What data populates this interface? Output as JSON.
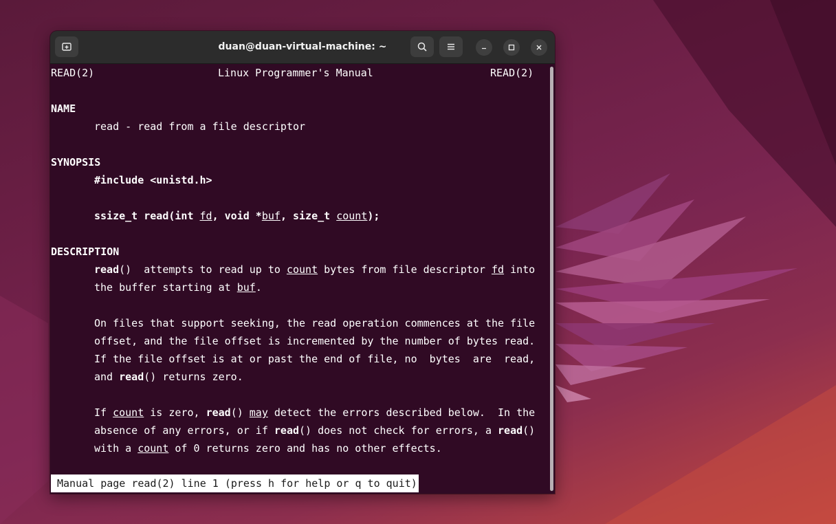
{
  "window": {
    "title": "duan@duan-virtual-machine: ~"
  },
  "icons": {
    "new_tab": "new-tab-icon",
    "search": "search-icon",
    "menu": "hamburger-menu-icon",
    "minimize": "minimize-icon",
    "maximize": "maximize-icon",
    "close": "close-icon"
  },
  "colors": {
    "terminal_bg": "#300a24",
    "terminal_fg": "#ffffff",
    "titlebar_bg": "#2c2c2c"
  },
  "man": {
    "header_left": "READ(2)",
    "header_center": "Linux Programmer's Manual",
    "header_right": "READ(2)",
    "name_heading": "NAME",
    "name_text": "read - read from a file descriptor",
    "synopsis_heading": "SYNOPSIS",
    "include": "#include <unistd.h>",
    "sig": {
      "part1": "ssize_t read(int ",
      "fd": "fd",
      "part2": ", void *",
      "buf": "buf",
      "part3": ", size_t ",
      "count": "count",
      "part4": ");"
    },
    "description_heading": "DESCRIPTION",
    "p1": {
      "l1_read": "read",
      "l1_a": "()  attempts to read up to ",
      "l1_count": "count",
      "l1_b": " bytes from file descriptor ",
      "l1_fd": "fd",
      "l1_c": " into",
      "l2_a": "the buffer starting at ",
      "l2_buf": "buf",
      "l2_b": "."
    },
    "p2": {
      "l1": "On files that support seeking, the read operation commences at the file",
      "l2": "offset, and the file offset is incremented by the number of bytes read.",
      "l3": "If the file offset is at or past the end of file, no  bytes  are  read,",
      "l4_a": "and ",
      "l4_read": "read",
      "l4_b": "() returns zero."
    },
    "p3": {
      "l1_a": "If ",
      "l1_count": "count",
      "l1_b": " is zero, ",
      "l1_read": "read",
      "l1_c": "() ",
      "l1_may": "may",
      "l1_d": " detect the errors described below.  In the",
      "l2_a": "absence of any errors, or if ",
      "l2_read": "read",
      "l2_b": "() does not check for errors, a ",
      "l2_read2": "read",
      "l2_c": "()",
      "l3_a": "with a ",
      "l3_count": "count",
      "l3_b": " of 0 returns zero and has no other effects."
    },
    "status": "Manual page read(2) line 1 (press h for help or q to quit)"
  }
}
